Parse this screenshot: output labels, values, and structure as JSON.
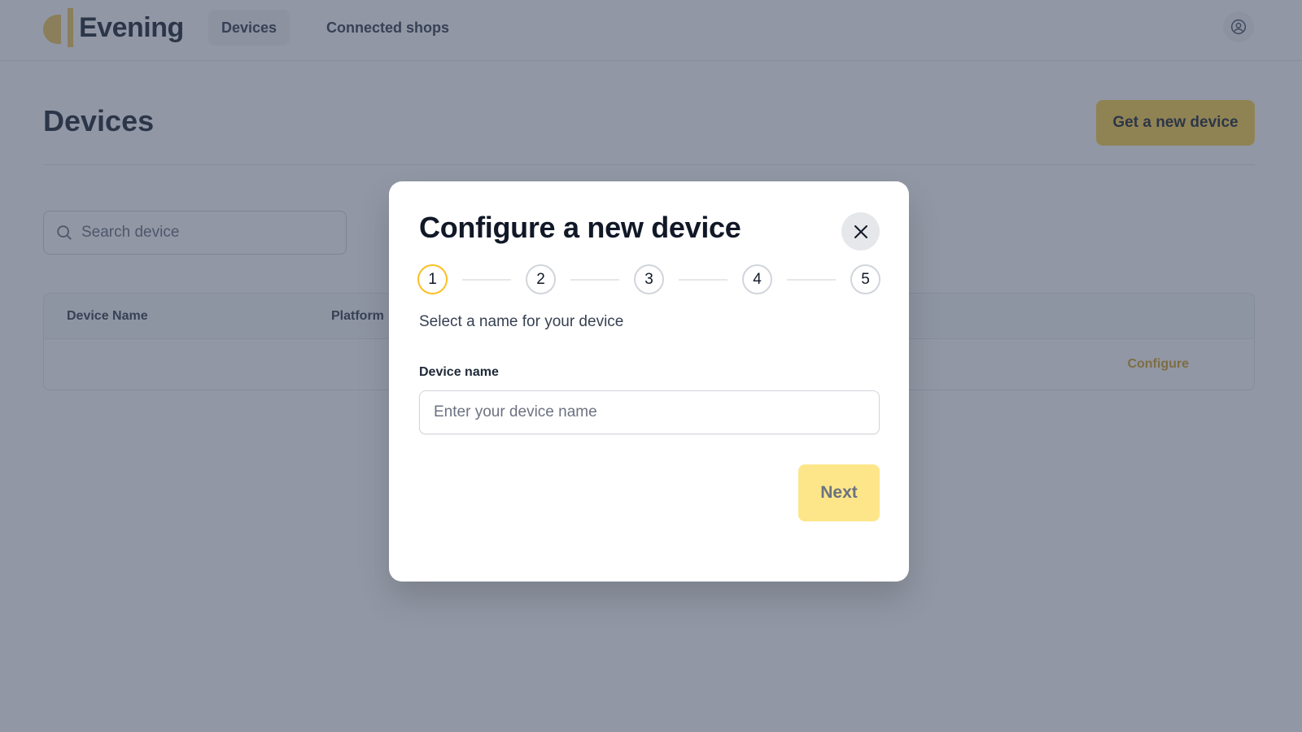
{
  "app": {
    "name": "Evening",
    "accent_color": "#fcd34d",
    "logo_color": "#f0c75e"
  },
  "nav": {
    "items": [
      {
        "label": "Devices",
        "active": true
      },
      {
        "label": "Connected shops",
        "active": false
      }
    ],
    "user_icon": "user-circle-icon"
  },
  "page": {
    "title": "Devices",
    "new_device_label": "Get a new device",
    "search_placeholder": "Search device",
    "table": {
      "columns": [
        "Device Name",
        "Platform"
      ],
      "rows": [
        {
          "action": "Configure"
        }
      ]
    }
  },
  "modal": {
    "title": "Configure a new device",
    "close_icon": "close-icon",
    "steps": [
      "1",
      "2",
      "3",
      "4",
      "5"
    ],
    "current_step": 1,
    "step_description": "Select a name for your device",
    "field_label": "Device name",
    "field_placeholder": "Enter your device name",
    "field_value": "",
    "next_label": "Next",
    "next_disabled": true
  }
}
